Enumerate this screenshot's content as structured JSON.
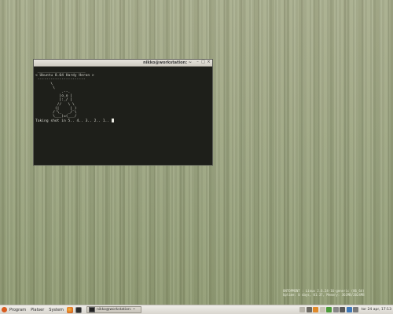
{
  "terminal": {
    "title": "nikko@workstation: ~",
    "lines": [
      " ______________________",
      "< Ubuntu 8.04 Hardy Heron >",
      " ----------------------",
      "       \\",
      "        \\",
      "            .--.",
      "           |o_o |",
      "           |:_/ |",
      "          //   \\ \\",
      "         (|     | )",
      "        /'\\_   _/`\\",
      "        \\___)=(___/",
      "",
      "Taking shot in 5.. 4.. 3.. 2.. 1.. "
    ]
  },
  "notice": {
    "line1": "ONTOPMENT : Linux 2.6.24-16-generic (86_64)",
    "line2": "Uptime: 0 days, 01:37, Memory: 361MB/2024MB"
  },
  "panel": {
    "menu": [
      "Program",
      "Platser",
      "System"
    ],
    "task_label": "nikko@workstation: ~",
    "clock": "tor 24 apr, 17:13"
  },
  "colors": {
    "desktop": "#9aa37e",
    "terminal_bg": "#1e1f1a",
    "terminal_fg": "#d8d8d0",
    "accent": "#d95c1f"
  }
}
